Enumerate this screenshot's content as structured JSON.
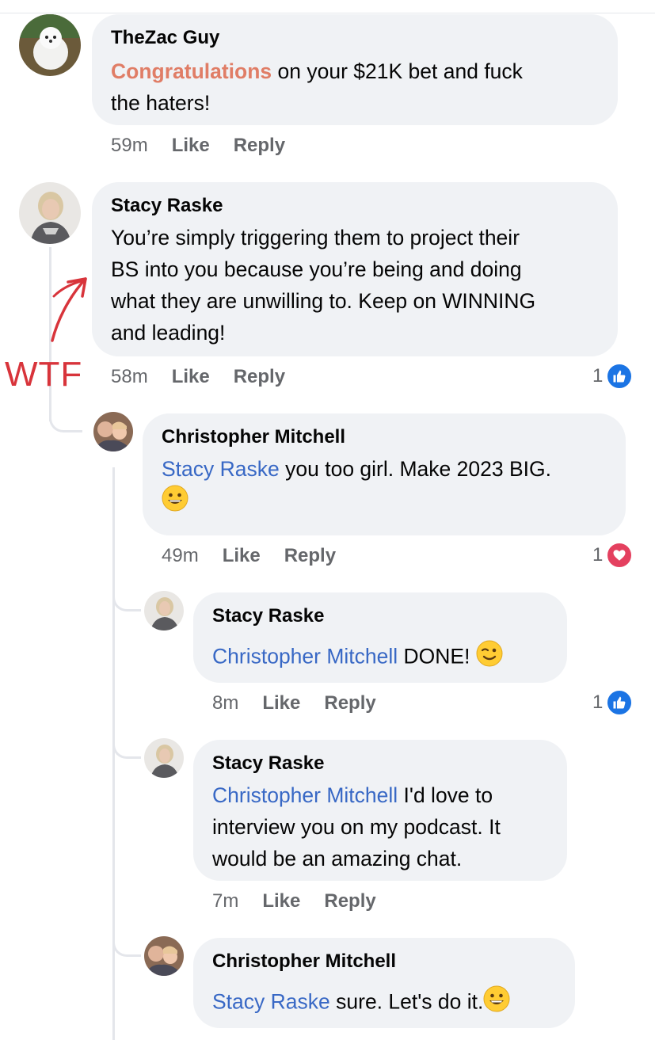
{
  "comments": [
    {
      "author": "TheZac Guy",
      "highlight": "Congratulations",
      "text_line1": " on your $21K bet and fuck",
      "text_line2": "the haters!",
      "time": "59m",
      "like": "Like",
      "reply": "Reply"
    },
    {
      "author": "Stacy Raske",
      "lines": [
        "You’re simply triggering them to project their",
        "BS into you because you’re being and doing",
        "what they are unwilling to. Keep on WINNING",
        "and leading!"
      ],
      "time": "58m",
      "like": "Like",
      "reply": "Reply",
      "reaction_count": "1",
      "reaction": "like-icon"
    },
    {
      "author": "Christopher Mitchell",
      "mention": "Stacy Raske",
      "text": " you too girl. Make 2023 BIG.",
      "time": "49m",
      "like": "Like",
      "reply": "Reply",
      "reaction_count": "1",
      "reaction": "love-icon"
    },
    {
      "author": "Stacy Raske",
      "mention": "Christopher Mitchell",
      "text": " DONE!",
      "time": "8m",
      "like": "Like",
      "reply": "Reply",
      "reaction_count": "1",
      "reaction": "like-icon"
    },
    {
      "author": "Stacy Raske",
      "mention": "Christopher Mitchell",
      "text_line1": " I'd love to",
      "text_line2": "interview you on my podcast. It",
      "text_line3": "would be an amazing chat.",
      "time": "7m",
      "like": "Like",
      "reply": "Reply"
    },
    {
      "author": "Christopher Mitchell",
      "mention": "Stacy Raske",
      "text": " sure. Let's do it.",
      "time": "",
      "like": "",
      "reply": ""
    }
  ],
  "annotation": {
    "text": "WTF",
    "color": "#d8343b"
  },
  "colors": {
    "bubble": "#f0f2f5",
    "mention": "#3868c5",
    "meta": "#65676b",
    "like_blue": "#1b74e4",
    "love_red": "#e4405f"
  }
}
